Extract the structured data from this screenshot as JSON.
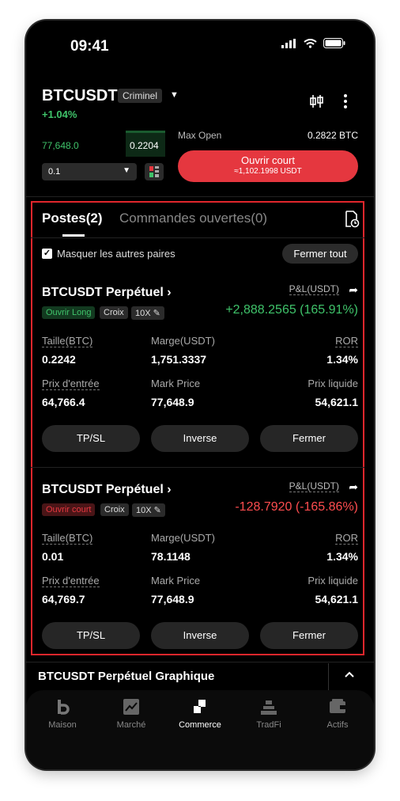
{
  "status_bar": {
    "time": "09:41"
  },
  "header": {
    "pair": "BTCUSDT",
    "tag": "Criminel",
    "change": "+1.04%"
  },
  "orderbook": {
    "price": "77,648.0",
    "qty": "0.2204"
  },
  "order_form": {
    "quantity_value": "0.1",
    "max_open_label": "Max Open",
    "max_open_value": "0.2822 BTC",
    "short_button_label": "Ouvrir court",
    "short_button_sub": "≈1,102.1998 USDT"
  },
  "tabs": {
    "positions": "Postes(2)",
    "open_orders": "Commandes ouvertes(0)"
  },
  "filters": {
    "hide_other_pairs": "Masquer les autres paires",
    "close_all": "Fermer tout"
  },
  "positions": [
    {
      "title": "BTCUSDT Perpétuel",
      "side": "Ouvrir Long",
      "margin_mode": "Croix",
      "leverage": "10X",
      "pnl_label": "P&L(USDT)",
      "pnl_value": "+2,888.2565 (165.91%)",
      "size_label": "Taille(BTC)",
      "size_value": "0.2242",
      "margin_label": "Marge(USDT)",
      "margin_value": "1,751.3337",
      "ror_label": "ROR",
      "ror_value": "1.34%",
      "entry_label": "Prix d'entrée",
      "entry_value": "64,766.4",
      "mark_label": "Mark Price",
      "mark_value": "77,648.9",
      "liq_label": "Prix liquide",
      "liq_value": "54,621.1",
      "btn_tpsl": "TP/SL",
      "btn_reverse": "Inverse",
      "btn_close": "Fermer"
    },
    {
      "title": "BTCUSDT Perpétuel",
      "side": "Ouvrir court",
      "margin_mode": "Croix",
      "leverage": "10X",
      "pnl_label": "P&L(USDT)",
      "pnl_value": "-128.7920 (-165.86%)",
      "size_label": "Taille(BTC)",
      "size_value": "0.01",
      "margin_label": "Marge(USDT)",
      "margin_value": "78.1148",
      "ror_label": "ROR",
      "ror_value": "1.34%",
      "entry_label": "Prix d'entrée",
      "entry_value": "64,769.7",
      "mark_label": "Mark Price",
      "mark_value": "77,648.9",
      "liq_label": "Prix liquide",
      "liq_value": "54,621.1",
      "btn_tpsl": "TP/SL",
      "btn_reverse": "Inverse",
      "btn_close": "Fermer"
    }
  ],
  "chart_bar": {
    "label": "BTCUSDT Perpétuel Graphique"
  },
  "bottom_nav": [
    {
      "label": "Maison",
      "icon": "home-icon"
    },
    {
      "label": "Marché",
      "icon": "market-chart-icon"
    },
    {
      "label": "Commerce",
      "icon": "trade-icon"
    },
    {
      "label": "TradFi",
      "icon": "tradfi-bars-icon"
    },
    {
      "label": "Actifs",
      "icon": "wallet-icon"
    }
  ],
  "colors": {
    "green": "#3fc36a",
    "red": "#e5373f",
    "highlight_border": "#e0262c"
  }
}
